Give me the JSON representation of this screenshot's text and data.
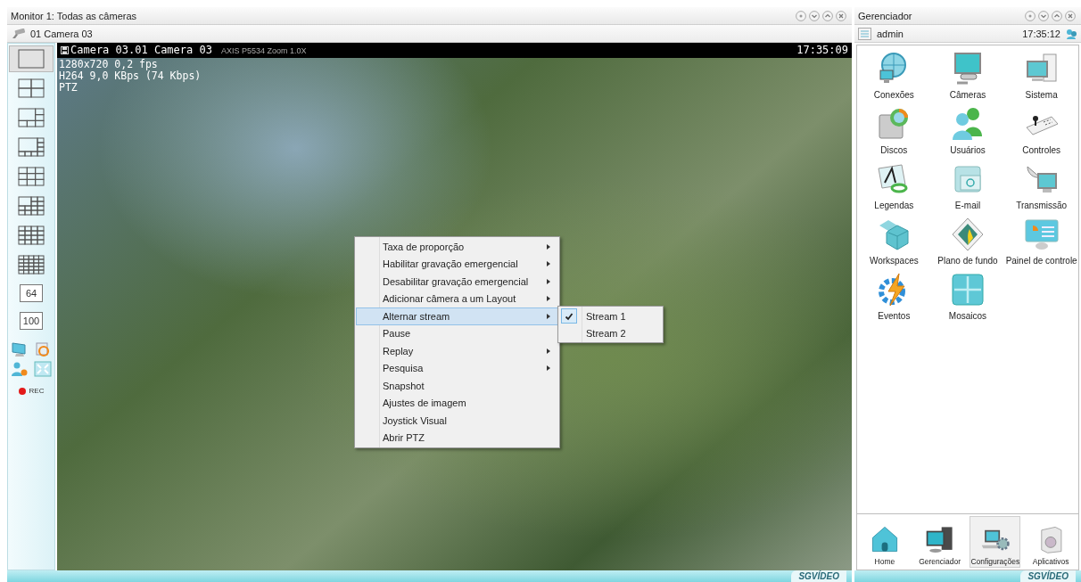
{
  "monitor": {
    "title": "Monitor 1: Todas as câmeras",
    "camera_label": "01 Camera 03",
    "layout_toolbar": [
      {
        "kind": "single",
        "selected": true
      },
      {
        "kind": "quad",
        "selected": false
      },
      {
        "kind": "six",
        "selected": false
      },
      {
        "kind": "eight",
        "selected": false
      },
      {
        "kind": "nine",
        "selected": false
      },
      {
        "kind": "thirteen",
        "selected": false
      },
      {
        "kind": "sixteen",
        "selected": false
      },
      {
        "kind": "twentyfive",
        "selected": false
      },
      {
        "kind": "count",
        "label": "64",
        "selected": false
      },
      {
        "kind": "count",
        "label": "100",
        "selected": false
      }
    ],
    "record_label": "REC",
    "video": {
      "overlay_title": "Camera 03.01 Camera 03",
      "overlay_subtitle": "AXIS P5534 Zoom 1.0X",
      "time": "17:35:09",
      "info": [
        "1280x720 0,2 fps",
        "H264 9,0 KBps (74 Kbps)",
        "PTZ"
      ]
    },
    "context_menu": [
      {
        "label": "Taxa de proporção",
        "submenu": true,
        "selected": false
      },
      {
        "label": "Habilitar gravação emergencial",
        "submenu": true,
        "selected": false
      },
      {
        "label": "Desabilitar gravação emergencial",
        "submenu": true,
        "selected": false
      },
      {
        "label": "Adicionar câmera a um Layout",
        "submenu": true,
        "selected": false
      },
      {
        "label": "Alternar stream",
        "submenu": true,
        "selected": true
      },
      {
        "label": "Pause",
        "submenu": false,
        "selected": false
      },
      {
        "label": "Replay",
        "submenu": true,
        "selected": false
      },
      {
        "label": "Pesquisa",
        "submenu": true,
        "selected": false
      },
      {
        "label": "Snapshot",
        "submenu": false,
        "selected": false
      },
      {
        "label": "Ajustes de imagem",
        "submenu": false,
        "selected": false
      },
      {
        "label": "Joystick Visual",
        "submenu": false,
        "selected": false
      },
      {
        "label": "Abrir PTZ",
        "submenu": false,
        "selected": false
      }
    ],
    "submenu": [
      {
        "label": "Stream 1",
        "checked": true
      },
      {
        "label": "Stream 2",
        "checked": false
      }
    ],
    "footer_logo": "SGVÍDEO"
  },
  "manager": {
    "title": "Gerenciador",
    "user": "admin",
    "time": "17:35:12",
    "apps": [
      "Conexões",
      "Câmeras",
      "Sistema",
      "Discos",
      "Usuários",
      "Controles",
      "Legendas",
      "E-mail",
      "Transmissão",
      "Workspaces",
      "Plano de fundo",
      "Painel de controle",
      "Eventos",
      "Mosaicos"
    ],
    "nav": [
      {
        "label": "Home",
        "selected": false
      },
      {
        "label": "Gerenciador",
        "selected": false
      },
      {
        "label": "Configurações",
        "selected": true
      },
      {
        "label": "Aplicativos",
        "selected": false
      }
    ],
    "footer_logo": "SGVÍDEO"
  }
}
